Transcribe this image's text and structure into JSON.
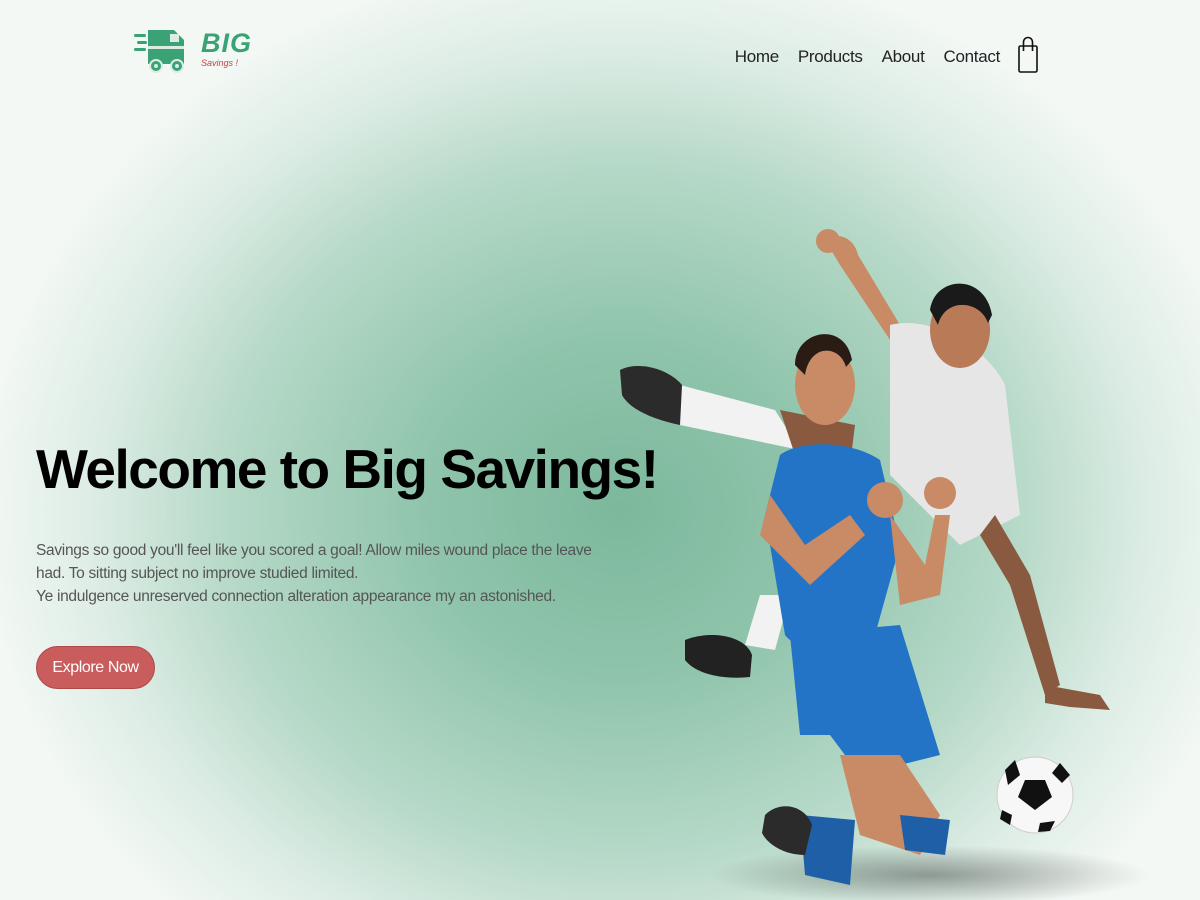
{
  "brand": {
    "name": "BIG",
    "tagline": "Savings !",
    "colors": {
      "green": "#3aa274",
      "red": "#c24242"
    },
    "icon": "delivery-truck-icon"
  },
  "nav": {
    "items": [
      {
        "label": "Home"
      },
      {
        "label": "Products"
      },
      {
        "label": "About"
      },
      {
        "label": "Contact"
      }
    ],
    "cart_icon": "shopping-bag-icon"
  },
  "hero": {
    "title": "Welcome to Big Savings!",
    "paragraph_lines": [
      "Savings so good you'll feel like you scored a goal! Allow miles wound place the leave had. To sitting subject no improve studied limited.",
      "Ye indulgence unreserved connection alteration appearance my an astonished."
    ],
    "cta_label": "Explore Now",
    "cta_color": "#c95c5c",
    "image_subject": "soccer-players-image"
  },
  "theme": {
    "background": "#8fc4ab"
  }
}
